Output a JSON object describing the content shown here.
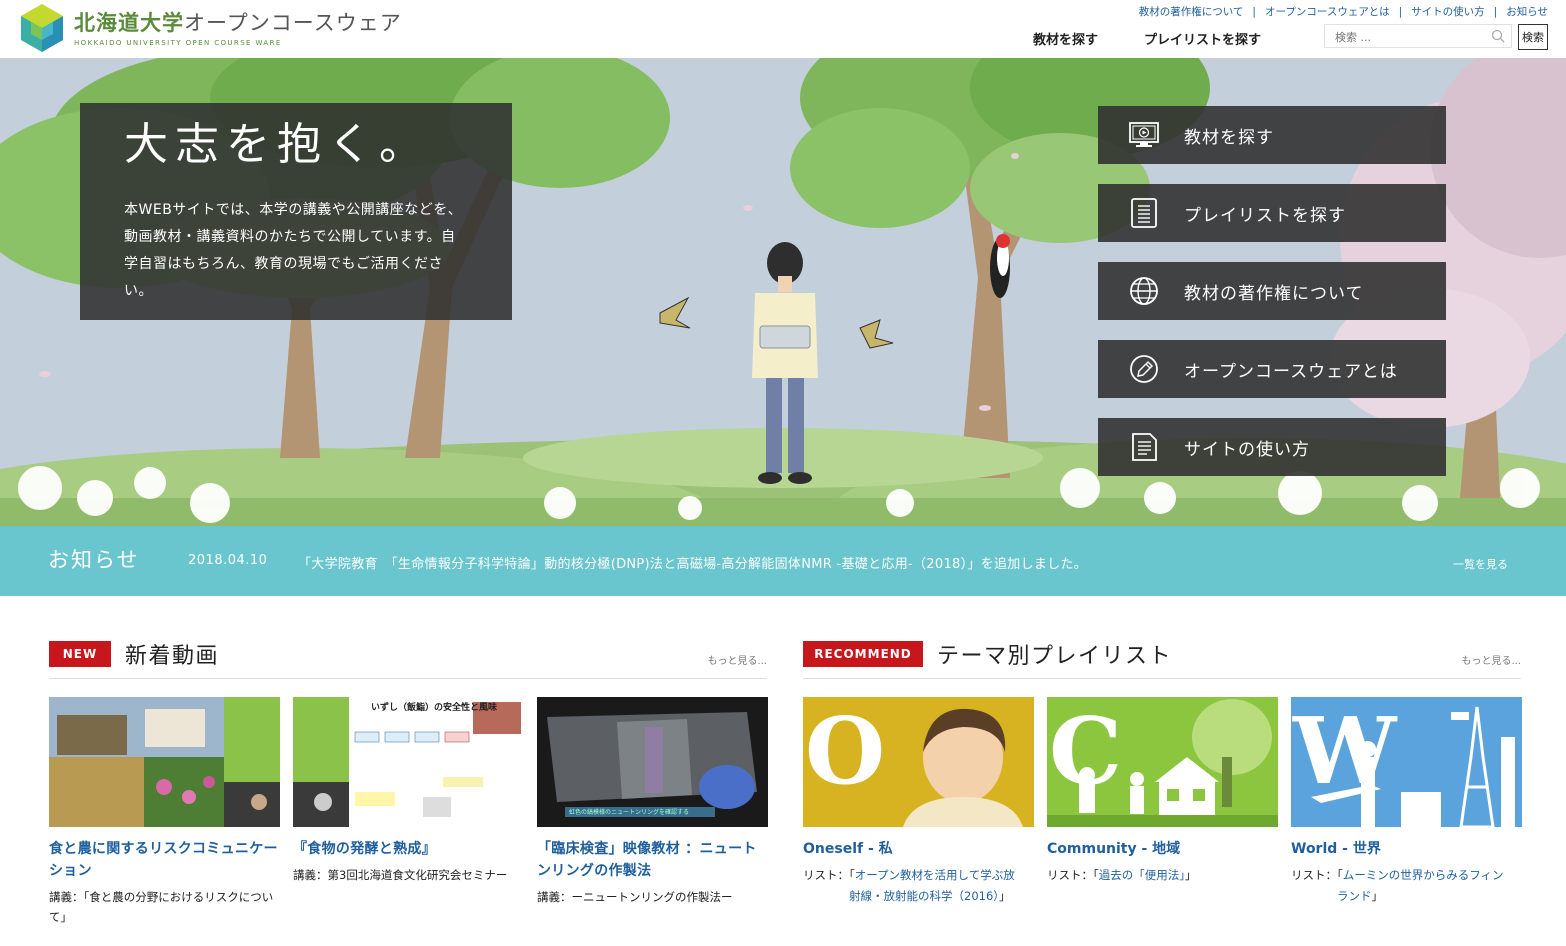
{
  "header": {
    "logo_title_kanji": "北海道大学",
    "logo_title_kana": "オープンコースウェア",
    "logo_subtitle": "HOKKAIDO UNIVERSITY OPEN COURSE WARE",
    "top_links": [
      "教材の著作権について",
      "オープンコースウェアとは",
      "サイトの使い方",
      "お知らせ"
    ],
    "nav": [
      "教材を探す",
      "プレイリストを探す"
    ],
    "search_placeholder": "検索 ...",
    "search_button": "検索"
  },
  "hero": {
    "title": "大志を抱く。",
    "text": "本WEBサイトでは、本学の講義や公開講座などを、動画教材・講義資料のかたちで公開しています。自学自習はもちろん、教育の現場でもご活用ください。",
    "menu": [
      {
        "label": "教材を探す",
        "icon": "monitor-play-icon"
      },
      {
        "label": "プレイリストを探す",
        "icon": "list-icon"
      },
      {
        "label": "教材の著作権について",
        "icon": "globe-icon"
      },
      {
        "label": "オープンコースウェアとは",
        "icon": "pencil-icon"
      },
      {
        "label": "サイトの使い方",
        "icon": "document-icon"
      }
    ]
  },
  "news": {
    "title": "お知らせ",
    "date": "2018.04.10",
    "text": "「大学院教育　「生命情報分子科学特論」動的核分極(DNP)法と高磁場-高分解能固体NMR -基礎と応用-（2018）」を追加しました。",
    "more": "一覧を見る"
  },
  "new_videos": {
    "badge": "NEW",
    "title": "新着動画",
    "more": "もっと見る...",
    "items": [
      {
        "title": "食と農に関するリスクコミュニケーション",
        "prefix": "講義：",
        "lecture": "「食と農の分野におけるリスクについて」"
      },
      {
        "title": "『食物の発酵と熟成』",
        "prefix": "講義：",
        "lecture": "第3回北海道食文化研究会セミナー"
      },
      {
        "title": "「臨床検査」映像教材 ：ニュートンリングの作製法",
        "prefix": "講義：",
        "lecture": "ーニュートンリングの作製法ー"
      }
    ],
    "thumb2_text": "いずし（飯鮨）の安全性と風味",
    "thumb3_caption": "虹色の縞模様のニュートンリングを確認する"
  },
  "playlists": {
    "badge": "RECOMMEND",
    "title": "テーマ別プレイリスト",
    "more": "もっと見る...",
    "items": [
      {
        "letter": "O",
        "title": "Oneself - 私",
        "prefix": "リスト：「",
        "link1": "オープン教材を活用して学ぶ放",
        "link2": "射線・放射能の科学（2016）",
        "suffix": "」",
        "color": "#d8b321"
      },
      {
        "letter": "C",
        "title": "Community - 地域",
        "prefix": "リスト：「",
        "link1": "過去の「便用法」",
        "link2": "",
        "suffix": "」",
        "color": "#8cc63f"
      },
      {
        "letter": "W",
        "title": "World - 世界",
        "prefix": "リスト：「",
        "link1": "ムーミンの世界からみるフィン",
        "link2": "ランド",
        "suffix": "」",
        "color": "#5ba3dc"
      }
    ]
  }
}
